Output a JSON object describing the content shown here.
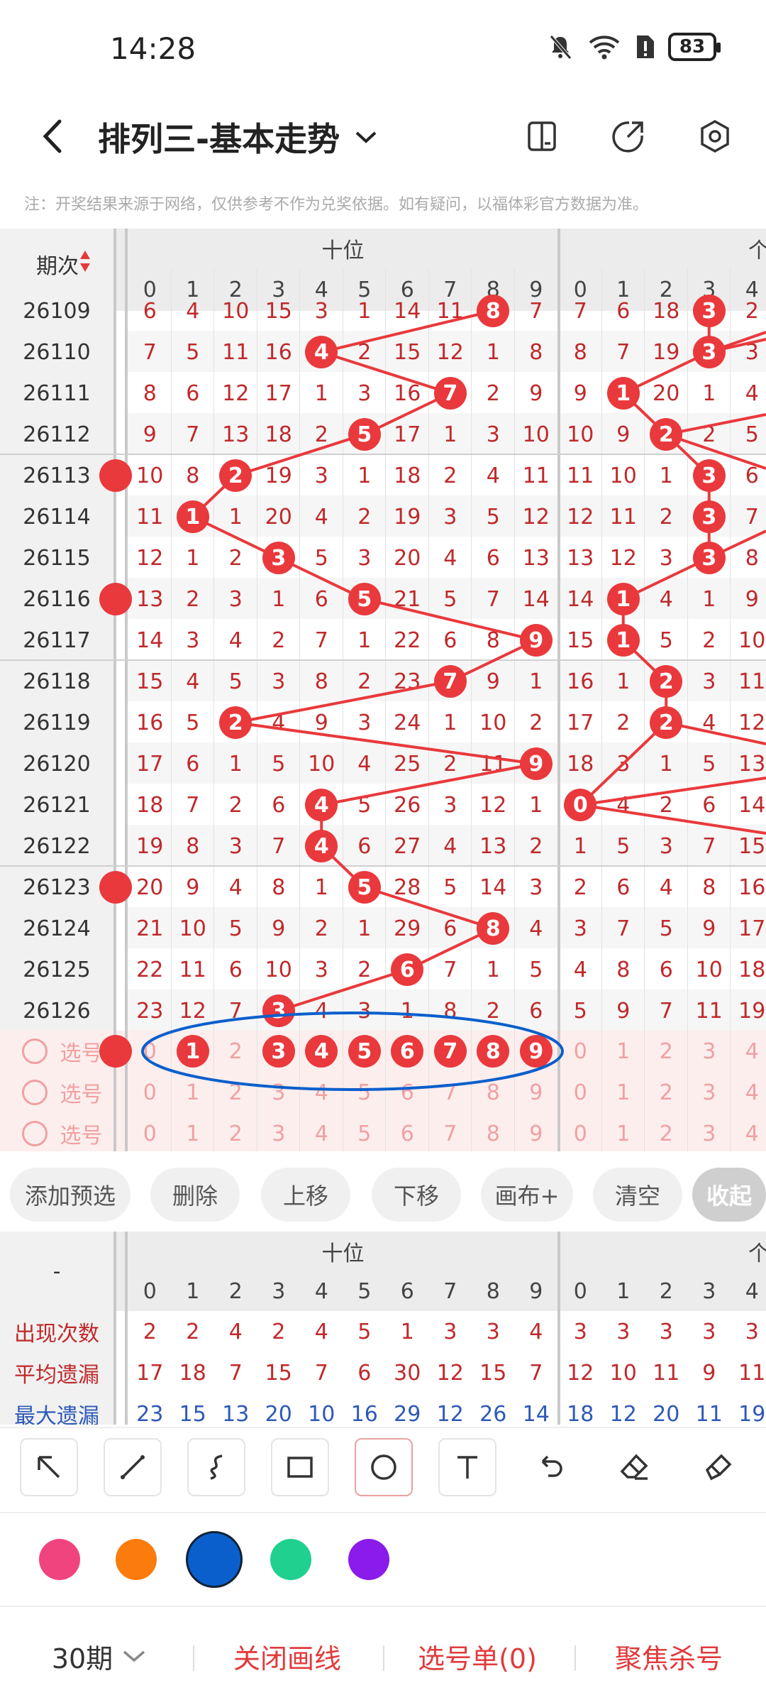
{
  "status": {
    "time": "14:28",
    "battery": "83"
  },
  "title": {
    "text": "排列三-基本走势"
  },
  "notice": "注：开奖结果来源于网络，仅供参考不作为兑奖依据。如有疑问，以福体彩官方数据为准。",
  "chart": {
    "period_header": "期次",
    "group_tens": "十位",
    "group_units": "个",
    "digits": [
      "0",
      "1",
      "2",
      "3",
      "4",
      "5",
      "6",
      "7",
      "8",
      "9"
    ],
    "rows": [
      {
        "period": "26109",
        "tens": [
          "6",
          "4",
          "10",
          "15",
          "3",
          "1",
          "14",
          "11",
          "8",
          "7"
        ],
        "units": [
          "7",
          "6",
          "18",
          "3",
          "2"
        ]
      },
      {
        "period": "26110",
        "tens": [
          "7",
          "5",
          "11",
          "16",
          "4",
          "2",
          "15",
          "12",
          "1",
          "8"
        ],
        "units": [
          "8",
          "7",
          "19",
          "3",
          "3"
        ]
      },
      {
        "period": "26111",
        "tens": [
          "8",
          "6",
          "12",
          "17",
          "1",
          "3",
          "16",
          "7",
          "2",
          "9"
        ],
        "units": [
          "9",
          "8",
          "20",
          "1",
          "4"
        ]
      },
      {
        "period": "26112",
        "tens": [
          "9",
          "7",
          "13",
          "18",
          "2",
          "5",
          "17",
          "1",
          "3",
          "10"
        ],
        "units": [
          "10",
          "9",
          "2",
          "2",
          "5"
        ]
      },
      {
        "period": "26113",
        "tens": [
          "10",
          "8",
          "2",
          "19",
          "3",
          "1",
          "18",
          "2",
          "4",
          "11"
        ],
        "units": [
          "11",
          "10",
          "1",
          "3",
          "6"
        ]
      },
      {
        "period": "26114",
        "tens": [
          "11",
          "1",
          "1",
          "20",
          "4",
          "2",
          "19",
          "3",
          "5",
          "12"
        ],
        "units": [
          "12",
          "11",
          "2",
          "4",
          "7"
        ]
      },
      {
        "period": "26115",
        "tens": [
          "12",
          "1",
          "2",
          "3",
          "5",
          "3",
          "20",
          "4",
          "6",
          "13"
        ],
        "units": [
          "13",
          "12",
          "3",
          "3",
          "8"
        ]
      },
      {
        "period": "26116",
        "tens": [
          "13",
          "2",
          "3",
          "1",
          "6",
          "5",
          "21",
          "5",
          "7",
          "14"
        ],
        "units": [
          "14",
          "1",
          "4",
          "1",
          "9"
        ]
      },
      {
        "period": "26117",
        "tens": [
          "14",
          "3",
          "4",
          "2",
          "7",
          "1",
          "22",
          "6",
          "8",
          "9"
        ],
        "units": [
          "15",
          "1",
          "5",
          "2",
          "10"
        ]
      },
      {
        "period": "26118",
        "tens": [
          "15",
          "4",
          "5",
          "3",
          "8",
          "2",
          "23",
          "7",
          "9",
          "1"
        ],
        "units": [
          "16",
          "1",
          "2",
          "3",
          "11"
        ]
      },
      {
        "period": "26119",
        "tens": [
          "16",
          "5",
          "2",
          "4",
          "9",
          "3",
          "24",
          "1",
          "10",
          "2"
        ],
        "units": [
          "17",
          "2",
          "2",
          "4",
          "12"
        ]
      },
      {
        "period": "26120",
        "tens": [
          "17",
          "6",
          "1",
          "5",
          "10",
          "4",
          "25",
          "2",
          "11",
          "9"
        ],
        "units": [
          "18",
          "3",
          "1",
          "5",
          "13"
        ]
      },
      {
        "period": "26121",
        "tens": [
          "18",
          "7",
          "2",
          "6",
          "4",
          "5",
          "26",
          "3",
          "12",
          "1"
        ],
        "units": [
          "0",
          "4",
          "2",
          "6",
          "14"
        ]
      },
      {
        "period": "26122",
        "tens": [
          "19",
          "8",
          "3",
          "7",
          "4",
          "6",
          "27",
          "4",
          "13",
          "2"
        ],
        "units": [
          "1",
          "5",
          "3",
          "7",
          "15"
        ]
      },
      {
        "period": "26123",
        "tens": [
          "20",
          "9",
          "4",
          "8",
          "1",
          "5",
          "28",
          "5",
          "14",
          "3"
        ],
        "units": [
          "2",
          "6",
          "4",
          "8",
          "16"
        ]
      },
      {
        "period": "26124",
        "tens": [
          "21",
          "10",
          "5",
          "9",
          "2",
          "1",
          "29",
          "6",
          "8",
          "4"
        ],
        "units": [
          "3",
          "7",
          "5",
          "9",
          "17"
        ]
      },
      {
        "period": "26125",
        "tens": [
          "22",
          "11",
          "6",
          "10",
          "3",
          "2",
          "6",
          "7",
          "1",
          "5"
        ],
        "units": [
          "4",
          "8",
          "6",
          "10",
          "18"
        ]
      },
      {
        "period": "26126",
        "tens": [
          "23",
          "12",
          "7",
          "3",
          "4",
          "3",
          "1",
          "8",
          "2",
          "6"
        ],
        "units": [
          "5",
          "9",
          "7",
          "11",
          "19"
        ]
      }
    ],
    "tens_hits": [
      8,
      4,
      7,
      5,
      2,
      1,
      3,
      5,
      9,
      7,
      2,
      9,
      4,
      4,
      5,
      8,
      6,
      3
    ],
    "units_hits": [
      3,
      3,
      1,
      2,
      3,
      3,
      3,
      1,
      1,
      2,
      2,
      null,
      0,
      null,
      null,
      null,
      null,
      null
    ],
    "select_label": "选号",
    "select_rows": [
      {
        "tens_selected": [
          "1",
          "3",
          "4",
          "5",
          "6",
          "7",
          "8",
          "9"
        ]
      },
      {
        "tens_selected": []
      },
      {
        "tens_selected": []
      }
    ]
  },
  "actions": [
    "添加预选",
    "删除",
    "上移",
    "下移",
    "画布+",
    "清空",
    "收起"
  ],
  "stats": {
    "header": "-",
    "rows": [
      {
        "label": "出现次数",
        "color": "#c0292b",
        "tens": [
          "2",
          "2",
          "4",
          "2",
          "4",
          "5",
          "1",
          "3",
          "3",
          "4"
        ],
        "units": [
          "3",
          "3",
          "3",
          "3",
          "3"
        ]
      },
      {
        "label": "平均遗漏",
        "color": "#c0292b",
        "tens": [
          "17",
          "18",
          "7",
          "15",
          "7",
          "6",
          "30",
          "12",
          "15",
          "7"
        ],
        "units": [
          "12",
          "10",
          "11",
          "9",
          "11"
        ]
      },
      {
        "label": "最大遗漏",
        "color": "#2e59b8",
        "tens": [
          "23",
          "15",
          "13",
          "20",
          "10",
          "16",
          "29",
          "12",
          "26",
          "14"
        ],
        "units": [
          "18",
          "12",
          "20",
          "11",
          "19"
        ]
      }
    ]
  },
  "draw_tools": [
    "arrow-icon",
    "line-icon",
    "curve-icon",
    "rectangle-icon",
    "circle-icon",
    "text-icon",
    "undo-icon",
    "eraser-icon",
    "clear-brush-icon"
  ],
  "colors": [
    "#f0447e",
    "#fb7b0c",
    "#0a5fcc",
    "#1fd08e",
    "#8a1bea"
  ],
  "bottom": {
    "periods": "30期",
    "close_lines": "关闭画线",
    "pick_list": "选号单(0)",
    "focus_kill": "聚焦杀号"
  }
}
